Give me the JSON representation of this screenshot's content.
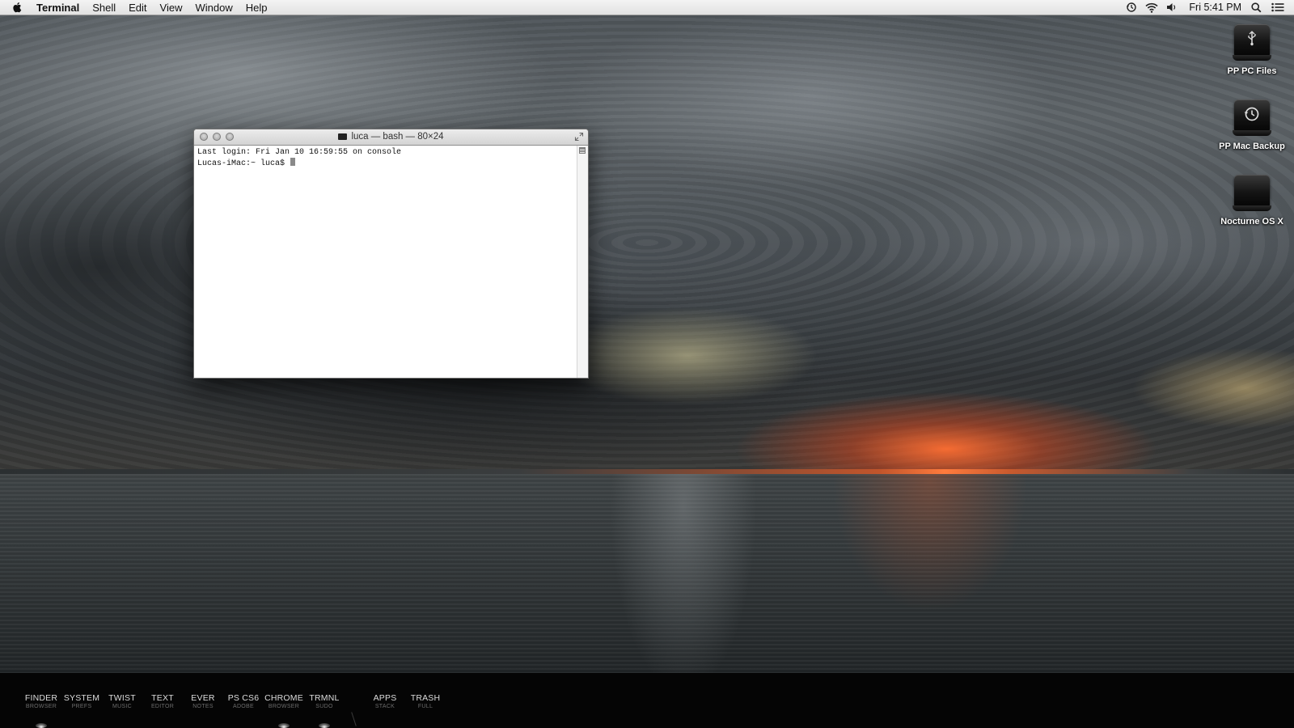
{
  "menubar": {
    "app_name": "Terminal",
    "items": [
      "Shell",
      "Edit",
      "View",
      "Window",
      "Help"
    ],
    "clock": "Fri 5:41 PM"
  },
  "desktop_icons": [
    {
      "label": "PP PC Files",
      "icon": "usb-drive-icon"
    },
    {
      "label": "PP Mac Backup",
      "icon": "time-machine-drive-icon"
    },
    {
      "label": "Nocturne OS X",
      "icon": "hard-drive-icon"
    }
  ],
  "terminal": {
    "title": "luca — bash — 80×24",
    "line1": "Last login: Fri Jan 10 16:59:55 on console",
    "prompt": "Lucas-iMac:~ luca$ "
  },
  "dock": [
    {
      "name": "FINDER",
      "sub": "BROWSER",
      "running": true
    },
    {
      "name": "SYSTEM",
      "sub": "PREFS",
      "running": false
    },
    {
      "name": "TWIST",
      "sub": "MUSIC",
      "running": false
    },
    {
      "name": "TEXT",
      "sub": "EDITOR",
      "running": false
    },
    {
      "name": "EVER",
      "sub": "NOTES",
      "running": false
    },
    {
      "name": "PS CS6",
      "sub": "ADOBE",
      "running": false
    },
    {
      "name": "CHROME",
      "sub": "BROWSER",
      "running": true
    },
    {
      "name": "TRMNL",
      "sub": "SUDO",
      "running": true
    },
    {
      "name": "APPS",
      "sub": "STACK",
      "running": false
    },
    {
      "name": "TRASH",
      "sub": "FULL",
      "running": false
    }
  ]
}
